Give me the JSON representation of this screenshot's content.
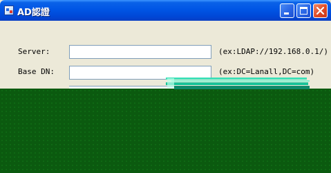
{
  "window": {
    "title": "AD認證"
  },
  "form": {
    "server": {
      "label": "Server:",
      "value": "",
      "hint": "(ex:LDAP://192.168.0.1/)"
    },
    "base_dn": {
      "label": "Base DN:",
      "value": "",
      "hint": "(ex:DC=Lanall,DC=com)"
    }
  },
  "icons": {
    "app": "app-icon",
    "minimize": "minimize-icon",
    "maximize": "maximize-icon",
    "close": "close-icon"
  },
  "colors": {
    "titlebar": "#0055e5",
    "window_body": "#ece9d8",
    "close_button": "#de4a25",
    "overlay": "#0b5a0f",
    "input_border": "#7f9db9"
  }
}
